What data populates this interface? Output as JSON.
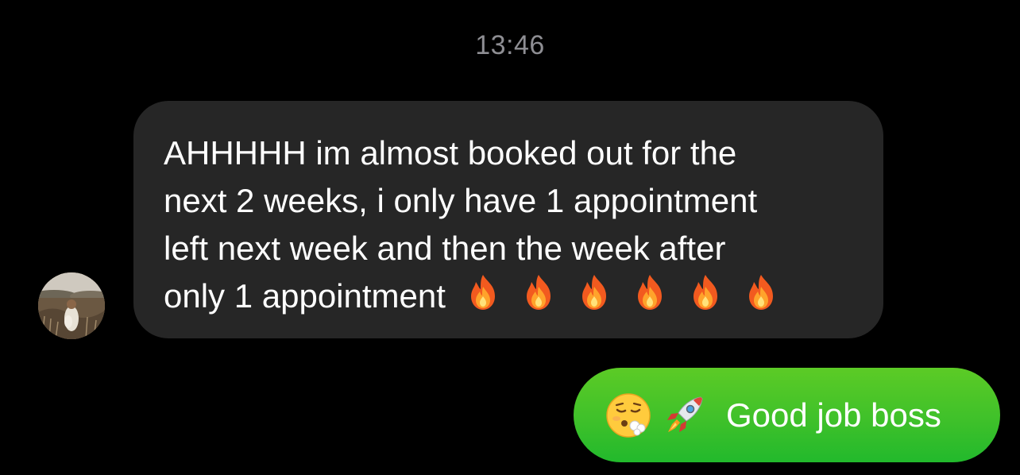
{
  "conversation": {
    "timestamp": "13:46",
    "incoming_message": {
      "lines": [
        "AHHHHH im almost booked out for the",
        "next 2 weeks, i only have 1 appointment",
        "left next week and then the week after",
        "only 1 appointment"
      ],
      "trailing_emojis": [
        "fire-icon",
        "fire-icon",
        "fire-icon",
        "fire-icon",
        "fire-icon",
        "fire-icon"
      ],
      "bubble_color": "#262626"
    },
    "outgoing_message": {
      "emojis": [
        "exhaling-face-icon",
        "rocket-icon"
      ],
      "text": "Good job boss",
      "bubble_color_top": "#5ccb26",
      "bubble_color_bottom": "#22b92c"
    },
    "avatar": "contact-avatar"
  },
  "colors": {
    "background": "#000000",
    "timestamp_text": "#8e8e93",
    "message_text": "#ffffff"
  }
}
